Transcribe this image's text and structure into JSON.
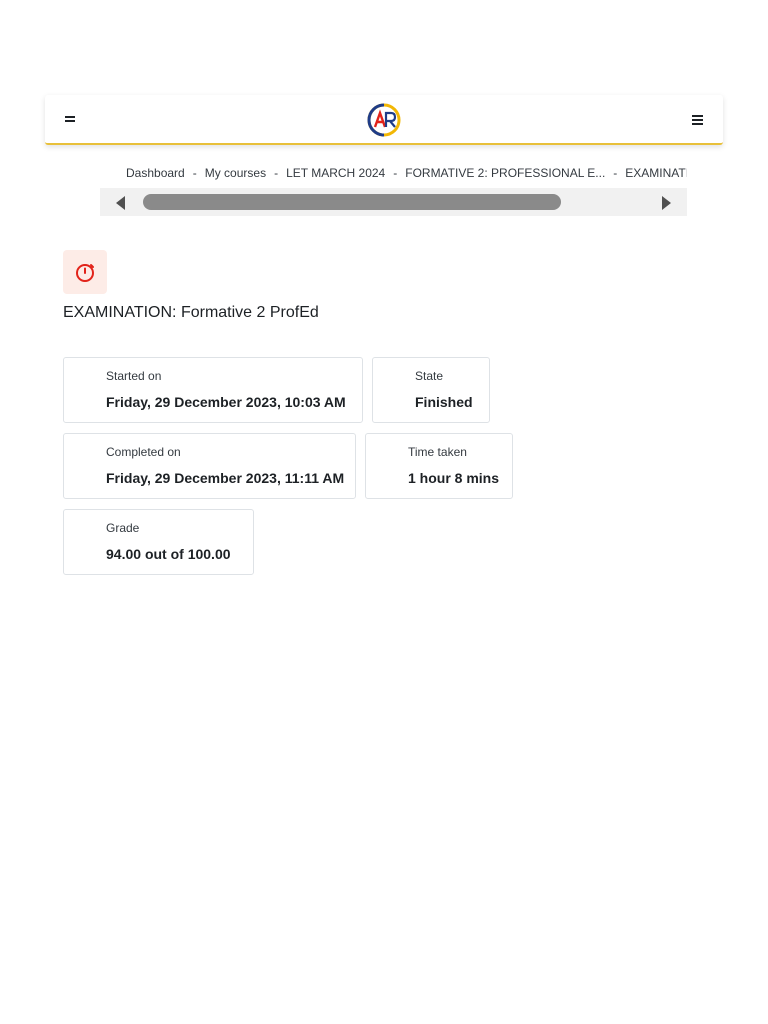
{
  "navbar": {
    "left_menu_icon": "drawer-toggle-icon",
    "right_menu_icon": "hamburger-menu-icon",
    "logo_icon": "site-logo",
    "accent_color": "#e8c03a"
  },
  "breadcrumb": {
    "items": [
      "Dashboard",
      "My courses",
      "LET MARCH 2024",
      "FORMATIVE 2: PROFESSIONAL E...",
      "EXAMINATION"
    ],
    "separator": "-"
  },
  "activity_icon": {
    "name": "stopwatch-icon",
    "color": "#e2231a",
    "background": "#fdece7"
  },
  "page": {
    "title": "EXAMINATION: Formative 2 ProfEd"
  },
  "summary": {
    "started_on": {
      "label": "Started on",
      "value": "Friday, 29 December 2023, 10:03 AM"
    },
    "state": {
      "label": "State",
      "value": "Finished"
    },
    "completed_on": {
      "label": "Completed on",
      "value": "Friday, 29 December 2023, 11:11 AM"
    },
    "time_taken": {
      "label": "Time taken",
      "value": "1 hour 8 mins"
    },
    "grade": {
      "label": "Grade",
      "score": "94.00",
      "suffix": "out of 100.00"
    }
  }
}
